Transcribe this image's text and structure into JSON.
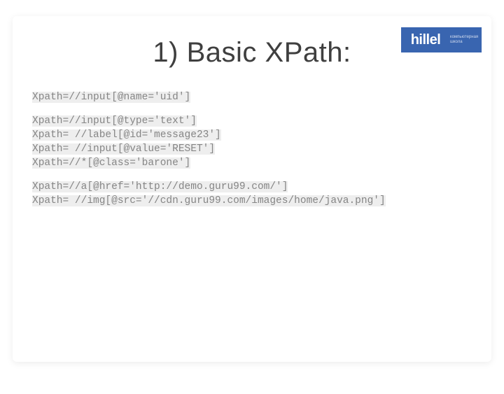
{
  "title": "1) Basic XPath:",
  "logo": {
    "brand": "hillel",
    "subtitle1": "компьютерная",
    "subtitle2": "школа"
  },
  "lines": {
    "l1": "Xpath=//input[@name='uid']",
    "l2": "Xpath=//input[@type='text']",
    "l3": "Xpath= //label[@id='message23']",
    "l4": "Xpath= //input[@value='RESET']",
    "l5": "Xpath=//*[@class='barone']",
    "l6": "Xpath=//a[@href='http://demo.guru99.com/']",
    "l7": "Xpath= //img[@src='//cdn.guru99.com/images/home/java.png']"
  }
}
